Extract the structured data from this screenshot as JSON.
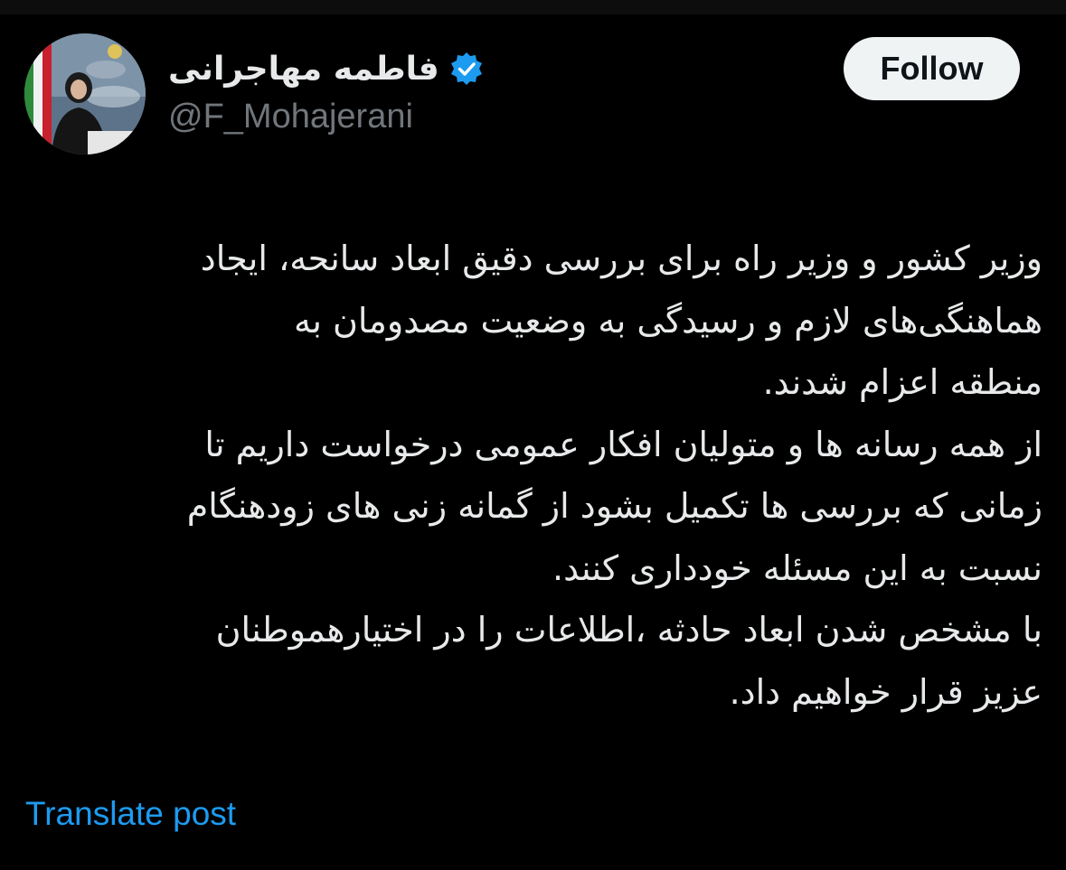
{
  "author": {
    "display_name": "فاطمه مهاجرانی",
    "handle": "@F_Mohajerani",
    "verified": true,
    "verified_icon": "verified-badge-icon",
    "accent_color": "#1d9bf0"
  },
  "follow_button": {
    "label": "Follow"
  },
  "post": {
    "lines": [
      "وزیر کشور و وزیر راه برای بررسی دقیق ابعاد سانحه، ایجاد",
      "هماهنگی‌های لازم و رسیدگی به وضعیت مصدومان به",
      "منطقه اعزام شدند.",
      "از همه رسانه ها و متولیان افکار عمومی درخواست داریم تا",
      "زمانی که بررسی ها تکمیل بشود از گمانه زنی های زودهنگام",
      "نسبت به این مسئله خودداری کنند.",
      "با مشخص شدن ابعاد حادثه ،اطلاعات را در اختیارهموطنان",
      "عزیز قرار خواهیم داد."
    ]
  },
  "translate": {
    "label": "Translate post"
  }
}
